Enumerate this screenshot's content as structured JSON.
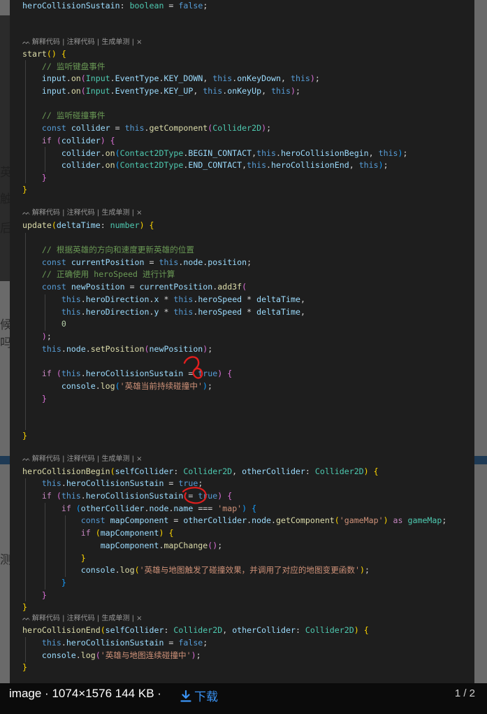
{
  "viewer": {
    "image_label": "image",
    "dimensions": "1074×1576",
    "size": "144 KB",
    "separator": "·",
    "download_label": "下载",
    "pager": "1 / 2"
  },
  "background": {
    "fragments": [
      "英",
      "触",
      "后",
      "候",
      "吗",
      "测"
    ]
  },
  "codelens": {
    "explain": "解释代码",
    "comment": "注释代码",
    "test": "生成单测",
    "close": "×"
  },
  "code": {
    "l1_prop": "heroCollisionSustain",
    "l1_colon": ": ",
    "l1_type": "boolean",
    "l1_eq": " = ",
    "l1_false": "false",
    "l1_semi": ";",
    "start_fn": "start",
    "paren_open": "(",
    "paren_close": ")",
    "brace_open": "{",
    "brace_close": "}",
    "comment_keyboard": "// 监听键盘事件",
    "input": "input",
    "dot": ".",
    "on": "on",
    "Input": "Input",
    "EventType": "EventType",
    "KEY_DOWN": "KEY_DOWN",
    "KEY_UP": "KEY_UP",
    "this": "this",
    "onKeyDown": "onKeyDown",
    "onKeyUp": "onKeyUp",
    "comma": ", ",
    "comma_tight": ",",
    "semi": ";",
    "comment_collision": "// 监听碰撞事件",
    "const": "const",
    "collider": "collider",
    "eq": " = ",
    "getComponent": "getComponent",
    "Collider2D": "Collider2D",
    "if": "if",
    "Contact2DType": "Contact2DType",
    "BEGIN_CONTACT": "BEGIN_CONTACT",
    "END_CONTACT": "END_CONTACT",
    "heroCollisionBegin": "heroCollisionBegin",
    "heroCollisionEnd": "heroCollisionEnd",
    "update": "update",
    "deltaTime": "deltaTime",
    "number": "number",
    "colon": ": ",
    "comment_update": "// 根据英雄的方向和速度更新英雄的位置",
    "currentPosition": "currentPosition",
    "node": "node",
    "position": "position",
    "comment_speed": "// 正确使用 heroSpeed 进行计算",
    "newPosition": "newPosition",
    "add3f": "add3f",
    "heroDirection": "heroDirection",
    "x": "x",
    "y": "y",
    "star": " * ",
    "heroSpeed": "heroSpeed",
    "zero": "0",
    "setPosition": "setPosition",
    "heroCollisionSustain": "heroCollisionSustain",
    "eqeq": " = ",
    "true": "true",
    "console": "console",
    "log": "log",
    "str_sustain": "'英雄当前持续碰撞中'",
    "selfCollider": "selfCollider",
    "otherCollider": "otherCollider",
    "name": "name",
    "triple": " === ",
    "str_map": "'map'",
    "mapComponent": "mapComponent",
    "str_gameMap": "'gameMap'",
    "as": " as ",
    "gameMap": "gameMap",
    "mapChange": "mapChange",
    "str_trigger": "'英雄与地图触发了碰撞效果，并调用了对应的地图变更函数'",
    "false": "false",
    "str_continue": "'英雄与地图连续碰撞中'"
  }
}
